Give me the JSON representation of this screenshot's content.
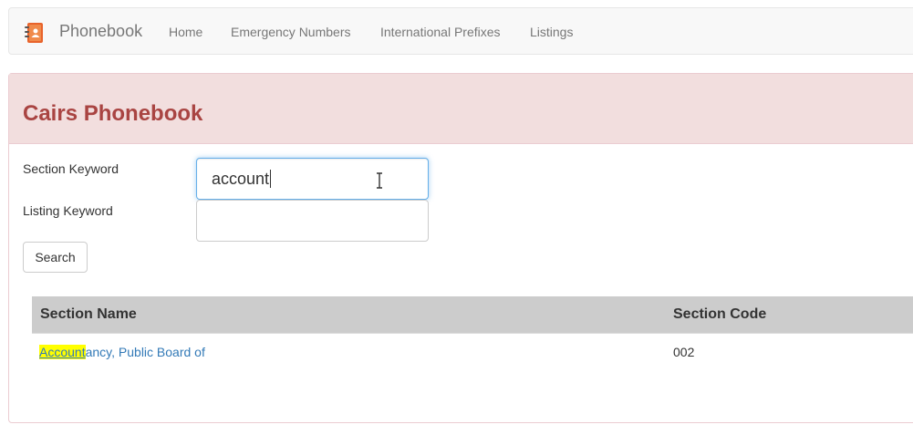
{
  "navbar": {
    "brand": "Phonebook",
    "brand_icon": "phonebook-icon",
    "links": [
      "Home",
      "Emergency Numbers",
      "International Prefixes",
      "Listings"
    ]
  },
  "panel": {
    "title": "Cairs Phonebook",
    "section_keyword_label": "Section Keyword",
    "section_keyword_value": "account",
    "listing_keyword_label": "Listing Keyword",
    "listing_keyword_value": "",
    "search_label": "Search"
  },
  "results": {
    "columns": [
      "Section Name",
      "Section Code"
    ],
    "rows": [
      {
        "name_match": "Account",
        "name_rest": "ancy, Public Board of",
        "code": "002"
      }
    ]
  },
  "colors": {
    "panel_heading_bg": "#f2dede",
    "panel_title": "#a94442",
    "link": "#337ab7",
    "highlight": "#ffff00",
    "table_header_bg": "#cccccc"
  }
}
